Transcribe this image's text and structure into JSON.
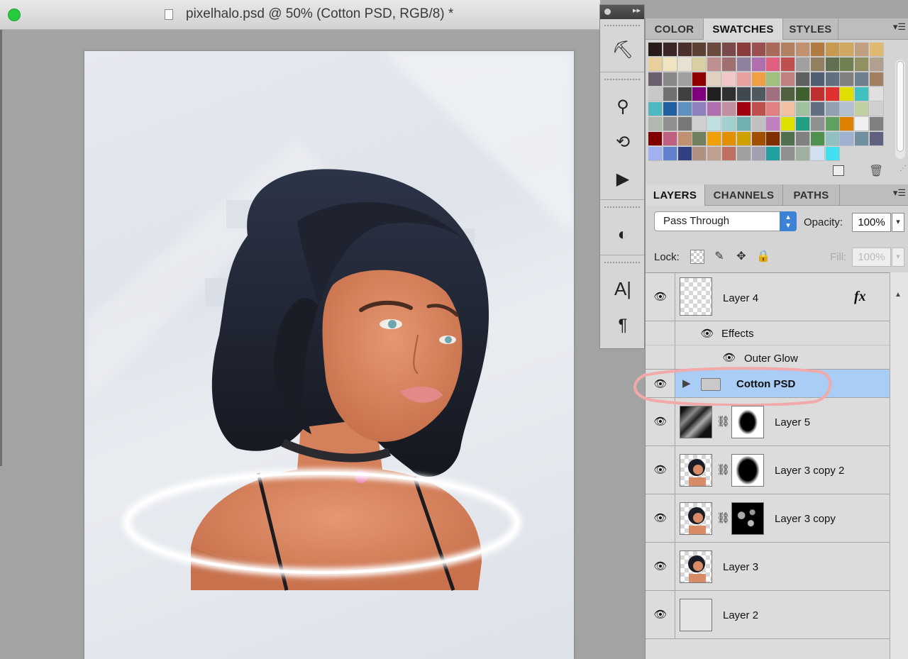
{
  "window": {
    "title": "pixelhalo.psd @ 50% (Cotton PSD, RGB/8) *"
  },
  "tools": [
    {
      "name": "brush-preset-tool",
      "glyph": "⛏"
    },
    {
      "name": "clone-source-tool",
      "glyph": "⚲"
    },
    {
      "name": "history-tool",
      "glyph": "⟲"
    },
    {
      "name": "actions-tool",
      "glyph": "▶"
    },
    {
      "name": "adjustments-tool",
      "glyph": "◐"
    },
    {
      "name": "character-tool",
      "glyph": "A|"
    },
    {
      "name": "paragraph-tool",
      "glyph": "¶"
    }
  ],
  "swatches_panel": {
    "tabs": [
      {
        "label": "COLOR"
      },
      {
        "label": "SWATCHES"
      },
      {
        "label": "STYLES"
      }
    ],
    "active_tab": "SWATCHES",
    "colors": [
      [
        "#2a1b1b",
        "#3a2626",
        "#4a2f2b",
        "#5c4034",
        "#6a4a3f",
        "#7a4a4a",
        "#8a3a3a",
        "#9a5050",
        "#aa6a5a",
        "#b08060",
        "#c09070",
        "#b07a40",
        "#c89a50",
        "#d0a860",
        "#c0a080",
        "#e0b870"
      ],
      [
        "#e8cf9c",
        "#f0e4c0",
        "#e8e0d0",
        "#d8d0a0",
        "#c09090",
        "#a07070",
        "#9080a0",
        "#b070b0",
        "#e06080",
        "#c05050",
        "#a0a0a0",
        "#908060",
        "#607050",
        "#708050",
        "#909060",
        "#b0a090"
      ],
      [
        "#6a6070",
        "#888888",
        "#a0a0a0",
        "#900000",
        "#e0d0c0",
        "#f0c8c8",
        "#e8a0a0",
        "#f0a040",
        "#a0c080",
        "#c08080",
        "#606060",
        "#506070",
        "#607080",
        "#808080",
        "#708090",
        "#a08060"
      ],
      [
        "#c8c8c8",
        "#707070",
        "#404040",
        "#800080",
        "#202020",
        "#303030",
        "#404850",
        "#505860",
        "#a07080",
        "#506040",
        "#406030",
        "#c03030",
        "#e03030",
        "#e0e000",
        "#40c0c0",
        "#e0e0e0"
      ],
      [
        "#50b8c0",
        "#2060a0",
        "#6090c0",
        "#9080c0",
        "#b070b0",
        "#c090a0",
        "#a00010",
        "#c05050",
        "#e08080",
        "#f0c0a0",
        "#a0c0a0",
        "#607080",
        "#90a0b0",
        "#b0c0d0",
        "#c0d0a0",
        "#d0d0d0"
      ],
      [
        "#b0b8b0",
        "#909090",
        "#787878",
        "#d0d0d0",
        "#c0e0e0",
        "#a0d0d0",
        "#70b0b0",
        "#c0c0c0",
        "#c080c0",
        "#e0e000",
        "#20a080",
        "#909090",
        "#60a060",
        "#e08000",
        "#f0f0f0",
        "#808080"
      ],
      [
        "#800000",
        "#c06080",
        "#c09070",
        "#708060",
        "#f0a000",
        "#e09000",
        "#d0a000",
        "#a05000",
        "#803000",
        "#507050",
        "#808080",
        "#509050",
        "#90c0c0",
        "#a0b0d0",
        "#7090a0",
        "#606080"
      ],
      [
        "#a0b0f0",
        "#6080d0",
        "#304080",
        "#b09080",
        "#c0a090",
        "#c07060",
        "#a0a0a0",
        "#a0a0b0",
        "#20a0a0",
        "#909090",
        "#a0b0a0",
        "#d0e0f0",
        "#40e0f0"
      ]
    ]
  },
  "layers_panel": {
    "tabs": [
      {
        "label": "LAYERS"
      },
      {
        "label": "CHANNELS"
      },
      {
        "label": "PATHS"
      }
    ],
    "active_tab": "LAYERS",
    "blend_mode": "Pass Through",
    "opacity_label": "Opacity:",
    "opacity_value": "100%",
    "lock_label": "Lock:",
    "fill_label": "Fill:",
    "fill_value": "100%",
    "fx_label": "fx",
    "layers": [
      {
        "name": "Layer 4",
        "type": "layer-with-fx"
      },
      {
        "name": "Effects",
        "type": "effects"
      },
      {
        "name": "Outer Glow",
        "type": "effect-item"
      },
      {
        "name": "Cotton PSD",
        "type": "group",
        "selected": true
      },
      {
        "name": "Layer 5",
        "type": "masked"
      },
      {
        "name": "Layer 3 copy 2",
        "type": "masked"
      },
      {
        "name": "Layer 3 copy",
        "type": "masked"
      },
      {
        "name": "Layer 3",
        "type": "portrait"
      },
      {
        "name": "Layer 2",
        "type": "blank"
      }
    ],
    "annotation_color": "#f2a9a9",
    "selection_color": "#a9cdf5"
  }
}
